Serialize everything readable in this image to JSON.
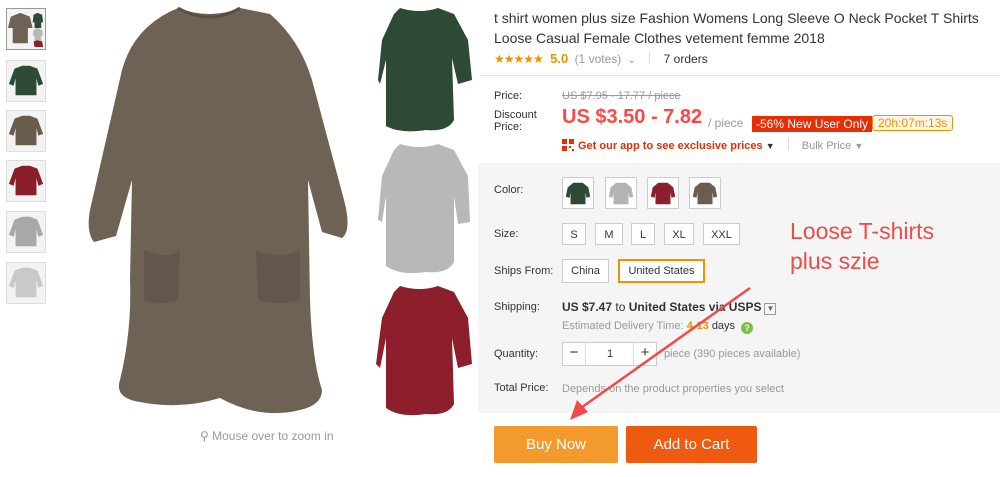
{
  "gallery": {
    "thumbnails": [
      {
        "name": "thumb-collage",
        "color": "#6f655a"
      },
      {
        "name": "thumb-green",
        "color": "#2f4a35"
      },
      {
        "name": "thumb-brown",
        "color": "#6a5c4c"
      },
      {
        "name": "thumb-red",
        "color": "#8a1f2a"
      },
      {
        "name": "thumb-gray",
        "color": "#a8a8a8"
      },
      {
        "name": "thumb-lightgray",
        "color": "#c9c9c9"
      }
    ],
    "zoom_hint": "Mouse over to zoom in",
    "main_colors": {
      "brown": "#6e6254",
      "green": "#2e4a36",
      "gray": "#b8b8b8",
      "red": "#8c1f2b"
    }
  },
  "product": {
    "title": "t shirt women plus size Fashion Womens Long Sleeve O Neck Pocket T Shirts Loose Casual Female Clothes vetement femme 2018",
    "stars": "★★★★★",
    "rating": "5.0",
    "votes": "(1 votes)",
    "orders": "7 orders"
  },
  "price": {
    "price_label": "Price:",
    "original": "US $7.95 - 17.77 / piece",
    "discount_label_1": "Discount",
    "discount_label_2": "Price:",
    "discount": "US $3.50 - 7.82",
    "per_piece": "/ piece",
    "promo_badge": "-56% New User Only",
    "timer": "20h:07m:13s",
    "app_promo": "Get our app to see exclusive prices",
    "bulk": "Bulk Price"
  },
  "options": {
    "color_label": "Color:",
    "colors": [
      {
        "name": "green",
        "hex": "#2e4a36"
      },
      {
        "name": "gray",
        "hex": "#b3b3b3"
      },
      {
        "name": "red",
        "hex": "#8c1f2b"
      },
      {
        "name": "brown",
        "hex": "#6a5e50"
      }
    ],
    "size_label": "Size:",
    "sizes": [
      "S",
      "M",
      "L",
      "XL",
      "XXL"
    ],
    "ships_from_label": "Ships From:",
    "ships_from": [
      "China",
      "United States"
    ],
    "ships_from_selected": "United States"
  },
  "shipping": {
    "label": "Shipping:",
    "cost": "US $7.47",
    "to": "to",
    "destination": "United States via USPS",
    "est_label": "Estimated Delivery Time:",
    "est_days": "4-13",
    "est_unit": "days"
  },
  "quantity": {
    "label": "Quantity:",
    "minus": "−",
    "value": "1",
    "plus": "+",
    "note": "piece (390 pieces available)"
  },
  "total": {
    "label": "Total Price:",
    "note": "Depends on the product properties you select"
  },
  "actions": {
    "buy_now": "Buy Now",
    "add_to_cart": "Add to Cart"
  },
  "annotation": {
    "line1": "Loose T-shirts",
    "line2": "plus szie",
    "color": "#f04a4a"
  }
}
